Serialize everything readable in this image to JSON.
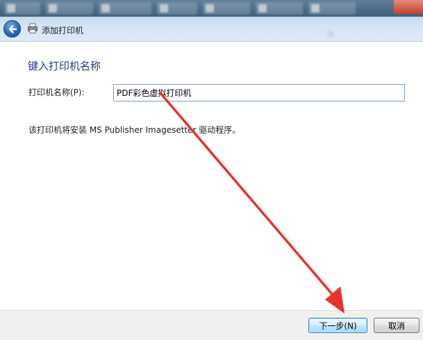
{
  "window": {
    "title": "添加打印机"
  },
  "header": {
    "ghost_labels": [
      "",
      "沙"
    ]
  },
  "page": {
    "heading": "键入打印机名称",
    "printer_name_label": "打印机名称(P):",
    "printer_name_value": "PDF彩色虚拟打印机",
    "driver_info": "该打印机将安装 MS Publisher Imagesetter 驱动程序。"
  },
  "footer": {
    "next_label": "下一步(N)",
    "cancel_label": "取消"
  },
  "icons": {
    "back": "back-arrow-icon",
    "printer": "printer-icon"
  },
  "colors": {
    "heading": "#1c3d8a",
    "annotation_arrow": "#e8322b"
  }
}
